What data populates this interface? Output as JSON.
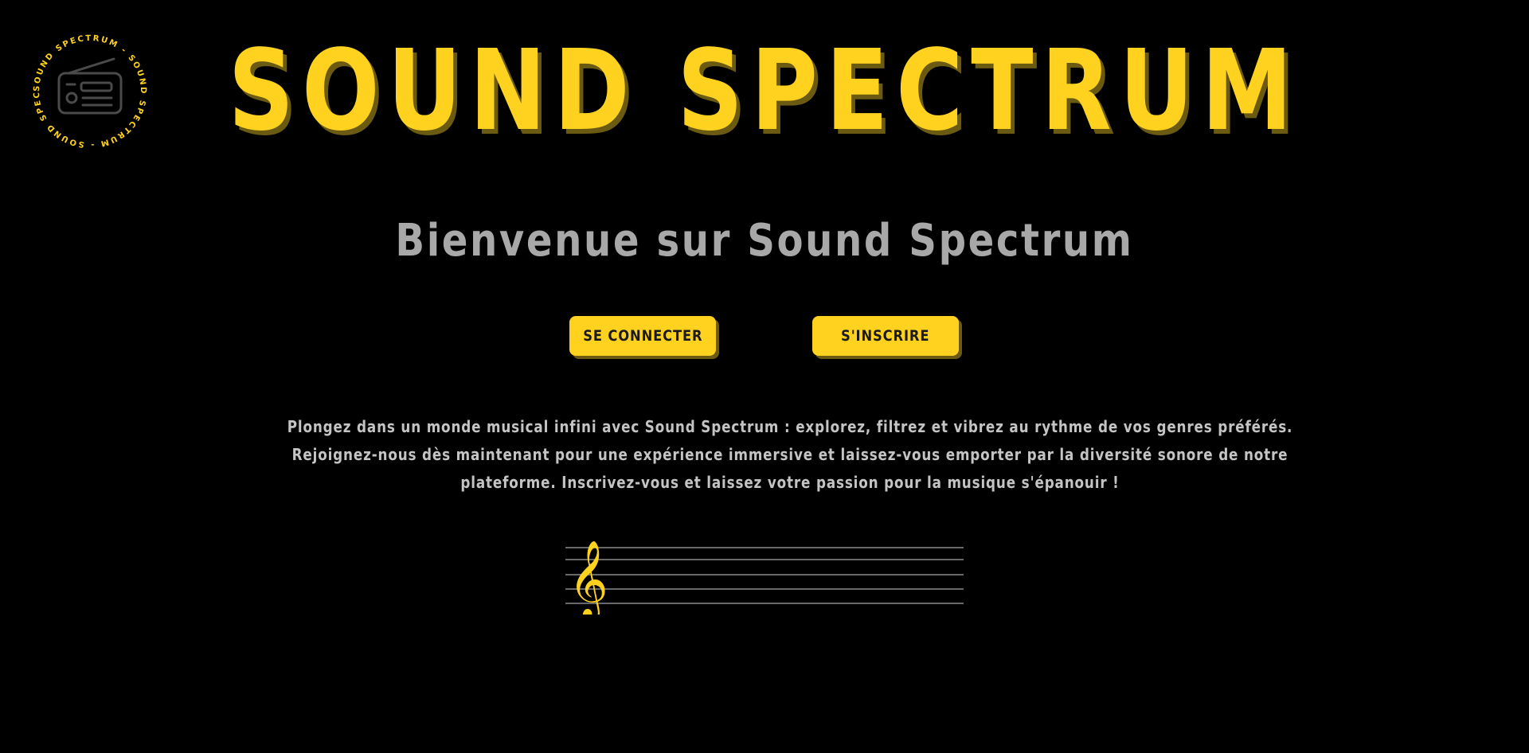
{
  "logo": {
    "ring_text": "SOUND SPECTRUM - SOUND SPECTRUM - SOUND SPECTRUM -",
    "icon": "radio-icon"
  },
  "header": {
    "title": "SOUND SPECTRUM"
  },
  "main": {
    "welcome": "Bienvenue sur Sound Spectrum",
    "buttons": {
      "login_label": "SE CONNECTER",
      "signup_label": "S'INSCRIRE"
    },
    "intro": "Plongez dans un monde musical infini avec Sound Spectrum : explorez, filtrez et vibrez au rythme de vos genres préférés. Rejoignez-nous dès maintenant pour une expérience immersive et laissez-vous emporter par la diversité sonore de notre plateforme. Inscrivez-vous et laissez votre passion pour la musique s'épanouir !",
    "staff": {
      "clef_icon": "treble-clef-icon",
      "clef_glyph": "𝄞"
    }
  },
  "colors": {
    "background": "#000000",
    "accent": "#ffd21f",
    "accent_shadow": "#6b5a12",
    "text": "#c4c4c4",
    "heading": "#a8a8a8",
    "staff_line": "#8a8a8a",
    "logo_icon": "#4a4a4a"
  }
}
